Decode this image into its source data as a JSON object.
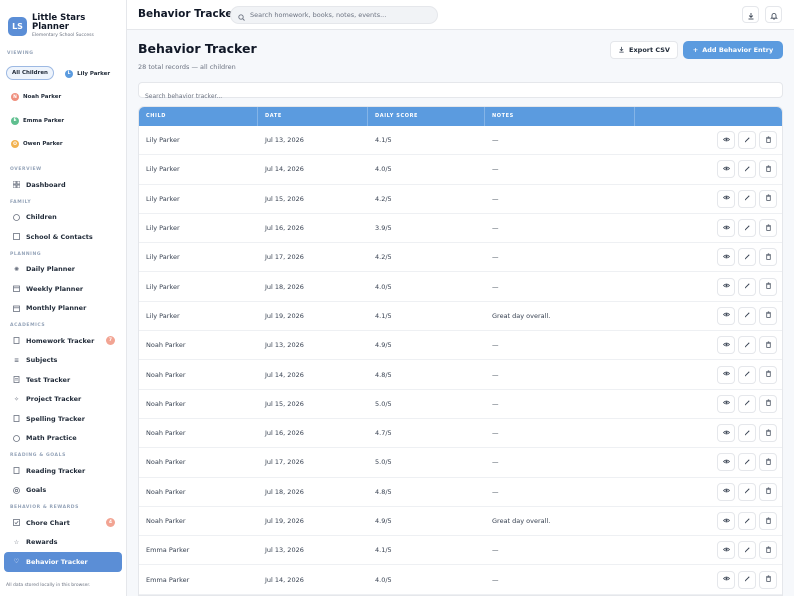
{
  "brand": {
    "logo": "LS",
    "title": "Little Stars Planner",
    "subtitle": "Elementary School Success"
  },
  "viewing": {
    "label": "VIEWING",
    "chips": [
      {
        "label": "All Children",
        "initial": "",
        "color": "",
        "active": true
      },
      {
        "label": "Lily Parker",
        "initial": "L",
        "color": "#5b9bdf",
        "active": false
      },
      {
        "label": "Noah Parker",
        "initial": "N",
        "color": "#ef8f7d",
        "active": false
      },
      {
        "label": "Emma Parker",
        "initial": "E",
        "color": "#5fbf8f",
        "active": false
      },
      {
        "label": "Owen Parker",
        "initial": "O",
        "color": "#f2b24f",
        "active": false
      }
    ]
  },
  "nav": {
    "overview": "OVERVIEW",
    "dashboard": "Dashboard",
    "family": "FAMILY",
    "children": "Children",
    "school": "School & Contacts",
    "planning": "PLANNING",
    "daily": "Daily Planner",
    "weekly": "Weekly Planner",
    "monthly": "Monthly Planner",
    "academics": "ACADEMICS",
    "homework": "Homework Tracker",
    "homework_badge": "7",
    "subjects": "Subjects",
    "test": "Test Tracker",
    "project": "Project Tracker",
    "spelling": "Spelling Tracker",
    "math": "Math Practice",
    "reading_goals": "READING & GOALS",
    "reading": "Reading Tracker",
    "goals": "Goals",
    "behavior_rewards": "BEHAVIOR & REWARDS",
    "chore": "Chore Chart",
    "chore_badge": "4",
    "rewards": "Rewards",
    "behavior": "Behavior Tracker",
    "footer": "All data stored locally in this browser."
  },
  "topbar": {
    "title": "Behavior Tracker",
    "search_placeholder": "Search homework, books, notes, events..."
  },
  "page": {
    "title": "Behavior Tracker",
    "subtitle": "28 total records — all children",
    "export_label": "Export CSV",
    "add_label": "Add Behavior Entry",
    "filter_placeholder": "Search behavior tracker..."
  },
  "table": {
    "columns": [
      "CHILD",
      "DATE",
      "DAILY SCORE",
      "NOTES",
      ""
    ],
    "rows": [
      {
        "child": "Lily Parker",
        "date": "Jul 13, 2026",
        "score": "4.1/5",
        "notes": "—"
      },
      {
        "child": "Lily Parker",
        "date": "Jul 14, 2026",
        "score": "4.0/5",
        "notes": "—"
      },
      {
        "child": "Lily Parker",
        "date": "Jul 15, 2026",
        "score": "4.2/5",
        "notes": "—"
      },
      {
        "child": "Lily Parker",
        "date": "Jul 16, 2026",
        "score": "3.9/5",
        "notes": "—"
      },
      {
        "child": "Lily Parker",
        "date": "Jul 17, 2026",
        "score": "4.2/5",
        "notes": "—"
      },
      {
        "child": "Lily Parker",
        "date": "Jul 18, 2026",
        "score": "4.0/5",
        "notes": "—"
      },
      {
        "child": "Lily Parker",
        "date": "Jul 19, 2026",
        "score": "4.1/5",
        "notes": "Great day overall."
      },
      {
        "child": "Noah Parker",
        "date": "Jul 13, 2026",
        "score": "4.9/5",
        "notes": "—"
      },
      {
        "child": "Noah Parker",
        "date": "Jul 14, 2026",
        "score": "4.8/5",
        "notes": "—"
      },
      {
        "child": "Noah Parker",
        "date": "Jul 15, 2026",
        "score": "5.0/5",
        "notes": "—"
      },
      {
        "child": "Noah Parker",
        "date": "Jul 16, 2026",
        "score": "4.7/5",
        "notes": "—"
      },
      {
        "child": "Noah Parker",
        "date": "Jul 17, 2026",
        "score": "5.0/5",
        "notes": "—"
      },
      {
        "child": "Noah Parker",
        "date": "Jul 18, 2026",
        "score": "4.8/5",
        "notes": "—"
      },
      {
        "child": "Noah Parker",
        "date": "Jul 19, 2026",
        "score": "4.9/5",
        "notes": "Great day overall."
      },
      {
        "child": "Emma Parker",
        "date": "Jul 13, 2026",
        "score": "4.1/5",
        "notes": "—"
      },
      {
        "child": "Emma Parker",
        "date": "Jul 14, 2026",
        "score": "4.0/5",
        "notes": "—"
      }
    ]
  },
  "colors": {
    "accent": "#5b9bdf",
    "sidebar_active": "#5b8ed6",
    "badge": "#f2a493"
  },
  "icons": {
    "view": "eye-icon",
    "edit": "pencil-icon",
    "delete": "trash-icon",
    "download": "download-icon",
    "notifications": "bell-icon",
    "search": "search-icon"
  }
}
